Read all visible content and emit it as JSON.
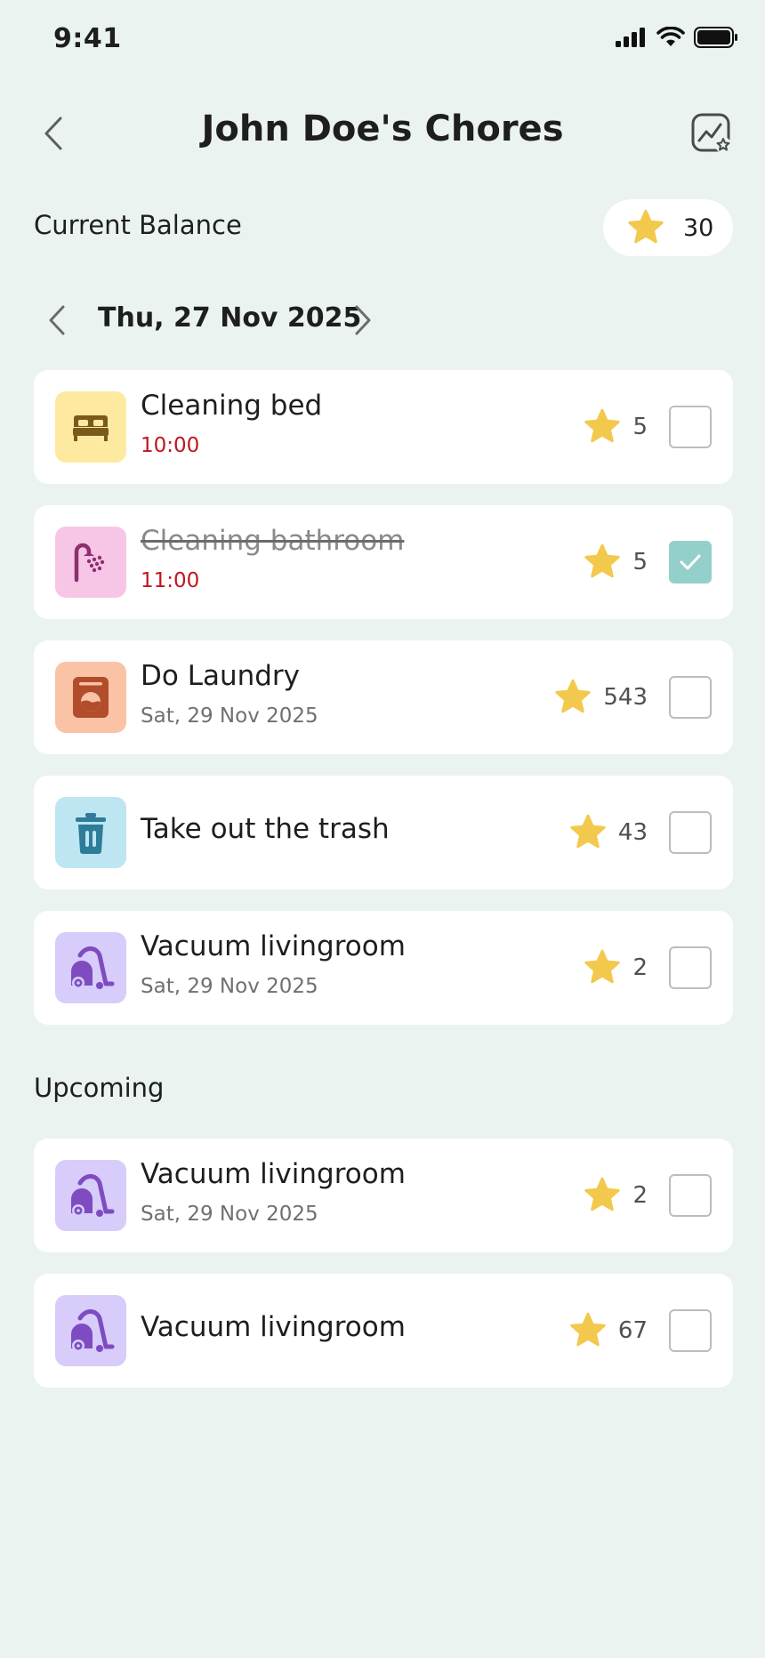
{
  "status": {
    "time": "9:41"
  },
  "header": {
    "title": "John Doe's Chores"
  },
  "balance": {
    "label": "Current Balance",
    "value": "30"
  },
  "date": {
    "label": "Thu, 27 Nov 2025"
  },
  "chores": [
    {
      "title": "Cleaning bed",
      "sub": "10:00",
      "reward": "5",
      "done": false,
      "icon": "bed-icon",
      "icon_bg": "#FDEAA0",
      "icon_color": "#7A5A1B"
    },
    {
      "title": "Cleaning bathroom",
      "sub": "11:00",
      "reward": "5",
      "done": true,
      "icon": "shower-icon",
      "icon_bg": "#F7C6E6",
      "icon_color": "#8E2F6F"
    },
    {
      "title": "Do Laundry",
      "sub": "Sat, 29 Nov 2025",
      "reward": "543",
      "done": false,
      "icon": "washing-machine-icon",
      "icon_bg": "#FBC3A6",
      "icon_color": "#B24D2C"
    },
    {
      "title": "Take out the trash",
      "sub": "",
      "reward": "43",
      "done": false,
      "icon": "trash-icon",
      "icon_bg": "#BDE6F2",
      "icon_color": "#2E7C99"
    },
    {
      "title": "Vacuum livingroom",
      "sub": "Sat, 29 Nov 2025",
      "reward": "2",
      "done": false,
      "icon": "vacuum-icon",
      "icon_bg": "#D7CCFA",
      "icon_color": "#7E4CC0"
    }
  ],
  "upcoming": {
    "label": "Upcoming",
    "items": [
      {
        "title": "Vacuum livingroom",
        "sub": "Sat, 29 Nov 2025",
        "reward": "2",
        "done": false,
        "icon": "vacuum-icon",
        "icon_bg": "#D7CCFA",
        "icon_color": "#7E4CC0"
      },
      {
        "title": "Vacuum livingroom",
        "sub": "",
        "reward": "67",
        "done": false,
        "icon": "vacuum-icon",
        "icon_bg": "#D7CCFA",
        "icon_color": "#7E4CC0"
      }
    ]
  },
  "colors": {
    "background": "#EBF3F0",
    "star": "#F2C94C",
    "time_text": "#C0161E",
    "checked": "#94D0CB"
  }
}
